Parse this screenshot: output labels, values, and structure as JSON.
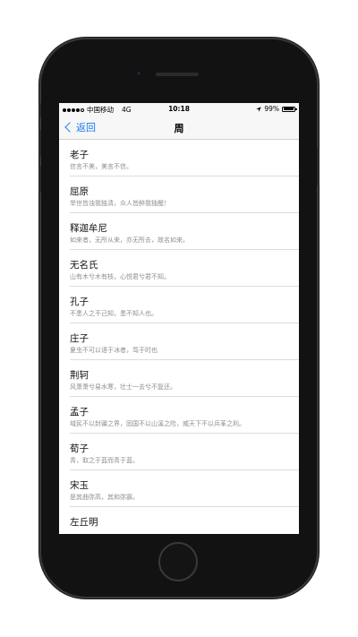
{
  "status_bar": {
    "carrier": "中国移动",
    "network": "4G",
    "time": "10:18",
    "battery_percent": "99%",
    "battery_level": 0.99,
    "location_icon": "location-arrow-icon"
  },
  "nav": {
    "back_label": "返回",
    "title": "周"
  },
  "list": [
    {
      "title": "老子",
      "subtitle": "信言不美，美言不信。"
    },
    {
      "title": "屈原",
      "subtitle": "举世皆浊我独清，众人皆醉我独醒！"
    },
    {
      "title": "释迦牟尼",
      "subtitle": "如来者，无所从来，亦无所去，故名如来。"
    },
    {
      "title": "无名氏",
      "subtitle": "山有木兮木有枝，心悦君兮君不知。"
    },
    {
      "title": "孔子",
      "subtitle": "不患人之不己知，患不知人也。"
    },
    {
      "title": "庄子",
      "subtitle": "夏虫不可以语于冰者，笃于时也"
    },
    {
      "title": "荆轲",
      "subtitle": "风萧萧兮易水寒，壮士一去兮不复还。"
    },
    {
      "title": "孟子",
      "subtitle": "域民不以封疆之界，固国不以山溪之险，威天下不以兵革之利。"
    },
    {
      "title": "荀子",
      "subtitle": "青，取之于蓝而青于蓝。"
    },
    {
      "title": "宋玉",
      "subtitle": "是其曲弥高，其和弥寡。"
    },
    {
      "title": "左丘明",
      "subtitle": ""
    }
  ],
  "colors": {
    "accent": "#1a7cf4",
    "subtitle": "#8e8e93",
    "bar_background": "#f7f7f7",
    "phone_body": "#121213"
  }
}
